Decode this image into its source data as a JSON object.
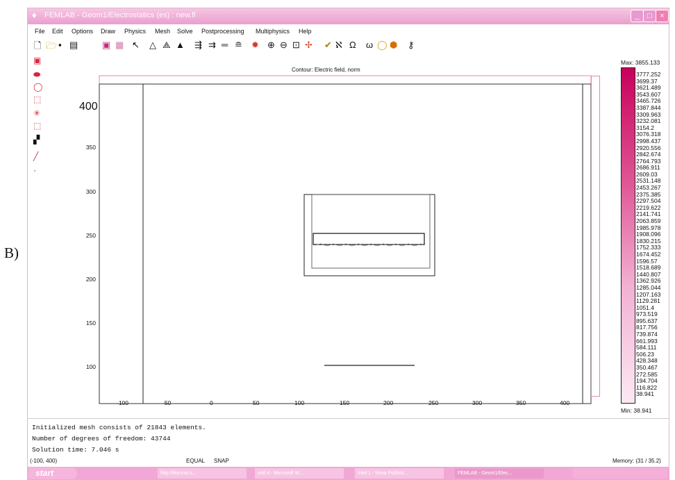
{
  "panel_label": "B)",
  "window": {
    "title": "FEMLAB - Geom1/Electrostatics (es) : new.fl",
    "buttons": [
      "_",
      "□",
      "×"
    ]
  },
  "menu": [
    "File",
    "Edit",
    "Options",
    "Draw",
    "Physics",
    "Mesh",
    "Solve",
    "Postprocessing",
    "Multiphysics",
    "Help"
  ],
  "toolbar_icons": [
    "new-icon",
    "open-icon",
    "save-icon",
    "print-icon",
    "copy-icon",
    "paste-icon",
    "pointer-icon",
    "triangle-icon",
    "triangle-mesh-icon",
    "triangle-refine-icon",
    "boundary-icon",
    "subdomain-icon",
    "equal-icon",
    "pde-icon",
    "solve-icon",
    "zoom-in-icon",
    "zoom-out-icon",
    "zoom-window-icon",
    "mesh-icon",
    "check-icon",
    "label-icon",
    "omega-icon",
    "circle-icon",
    "tag-icon",
    "key-icon"
  ],
  "left_tools": [
    "rectangle-icon",
    "ellipse-icon",
    "circle-icon",
    "square-icon",
    "star-icon",
    "dotted-rect-icon",
    "clapper-icon",
    "line-icon",
    "point-icon"
  ],
  "plot": {
    "title": "Contour: Electric field, norm",
    "x_ticks": [
      "-100",
      "-50",
      "0",
      "50",
      "100",
      "150",
      "200",
      "250",
      "300",
      "350",
      "400"
    ],
    "y_ticks": [
      "400",
      "350",
      "300",
      "250",
      "200",
      "150",
      "100"
    ]
  },
  "legend": {
    "max_label": "Max: 3855.133",
    "min_label": "Min: 38.941",
    "values": [
      "3777.252",
      "3699.37",
      "3621.489",
      "3543.607",
      "3465.726",
      "3387.844",
      "3309.963",
      "3232.081",
      "3154.2",
      "3076.318",
      "2998.437",
      "2920.556",
      "2842.674",
      "2764.793",
      "2686.911",
      "2609.03",
      "2531.148",
      "2453.267",
      "2375.385",
      "2297.504",
      "2219.622",
      "2141.741",
      "2063.859",
      "1985.978",
      "1908.096",
      "1830.215",
      "1752.333",
      "1674.452",
      "1596.57",
      "1518.689",
      "1440.807",
      "1362.926",
      "1285.044",
      "1207.163",
      "1129.281",
      "1051.4",
      "973.519",
      "895.637",
      "817.756",
      "739.874",
      "661.993",
      "584.111",
      "506.23",
      "428.348",
      "350.467",
      "272.585",
      "194.704",
      "116.822",
      "38.941"
    ]
  },
  "console": [
    "Initialized mesh consists of 21843 elements.",
    "Number of degrees of freedom: 43744",
    "Solution time: 7.046 s"
  ],
  "status": {
    "coords": "(-100, 400)",
    "equal": "EQUAL",
    "snap": "SNAP",
    "memory": "Memory: (31 / 35.2)"
  },
  "taskbar": {
    "start": "start",
    "items": [
      "http://fea.mst.s...",
      "untl 4 - Microsoft W...",
      "Intel 1 - Nova Publish...",
      "FEMLAB - Geom1/Elec..."
    ]
  }
}
